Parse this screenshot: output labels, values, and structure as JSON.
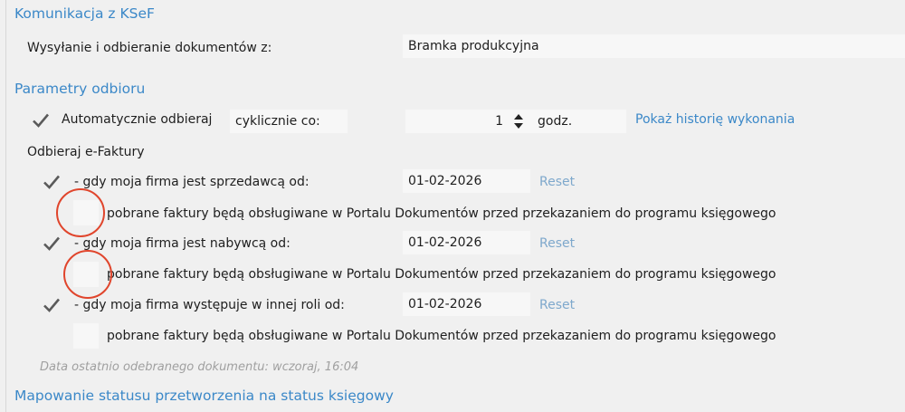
{
  "sections": {
    "ksef": "Komunikacja z KSeF",
    "receive_params": "Parametry odbioru",
    "status_mapping": "Mapowanie statusu przetworzenia na status księgowy"
  },
  "sending": {
    "label": "Wysyłanie i odbieranie dokumentów z:",
    "value": "Bramka produkcyjna"
  },
  "auto_receive": {
    "label": "Automatycznie odbieraj",
    "mode": "cyklicznie co:",
    "interval": "1",
    "unit": "godz.",
    "history_link": "Pokaż historię wykonania"
  },
  "invoices_header": "Odbieraj e-Faktury",
  "rows": [
    {
      "label": "- gdy moja firma jest sprzedawcą od:",
      "date": "01-02-2026",
      "reset": "Reset",
      "portal_label": "pobrane faktury będą obsługiwane w Portalu Dokumentów przed przekazaniem do programu księgowego"
    },
    {
      "label": "- gdy moja firma jest nabywcą od:",
      "date": "01-02-2026",
      "reset": "Reset",
      "portal_label": "pobrane faktury będą obsługiwane w Portalu Dokumentów przed przekazaniem do programu księgowego"
    },
    {
      "label": "- gdy moja firma występuje w innej roli od:",
      "date": "01-02-2026",
      "reset": "Reset",
      "portal_label": "pobrane faktury będą obsługiwane w Portalu Dokumentów przed przekazaniem do programu księgowego"
    }
  ],
  "last_document": "Data ostatnio odebranego dokumentu: wczoraj, 16:04",
  "colors": {
    "accent": "#3b88c8",
    "annotation_circle": "#e0452c"
  }
}
